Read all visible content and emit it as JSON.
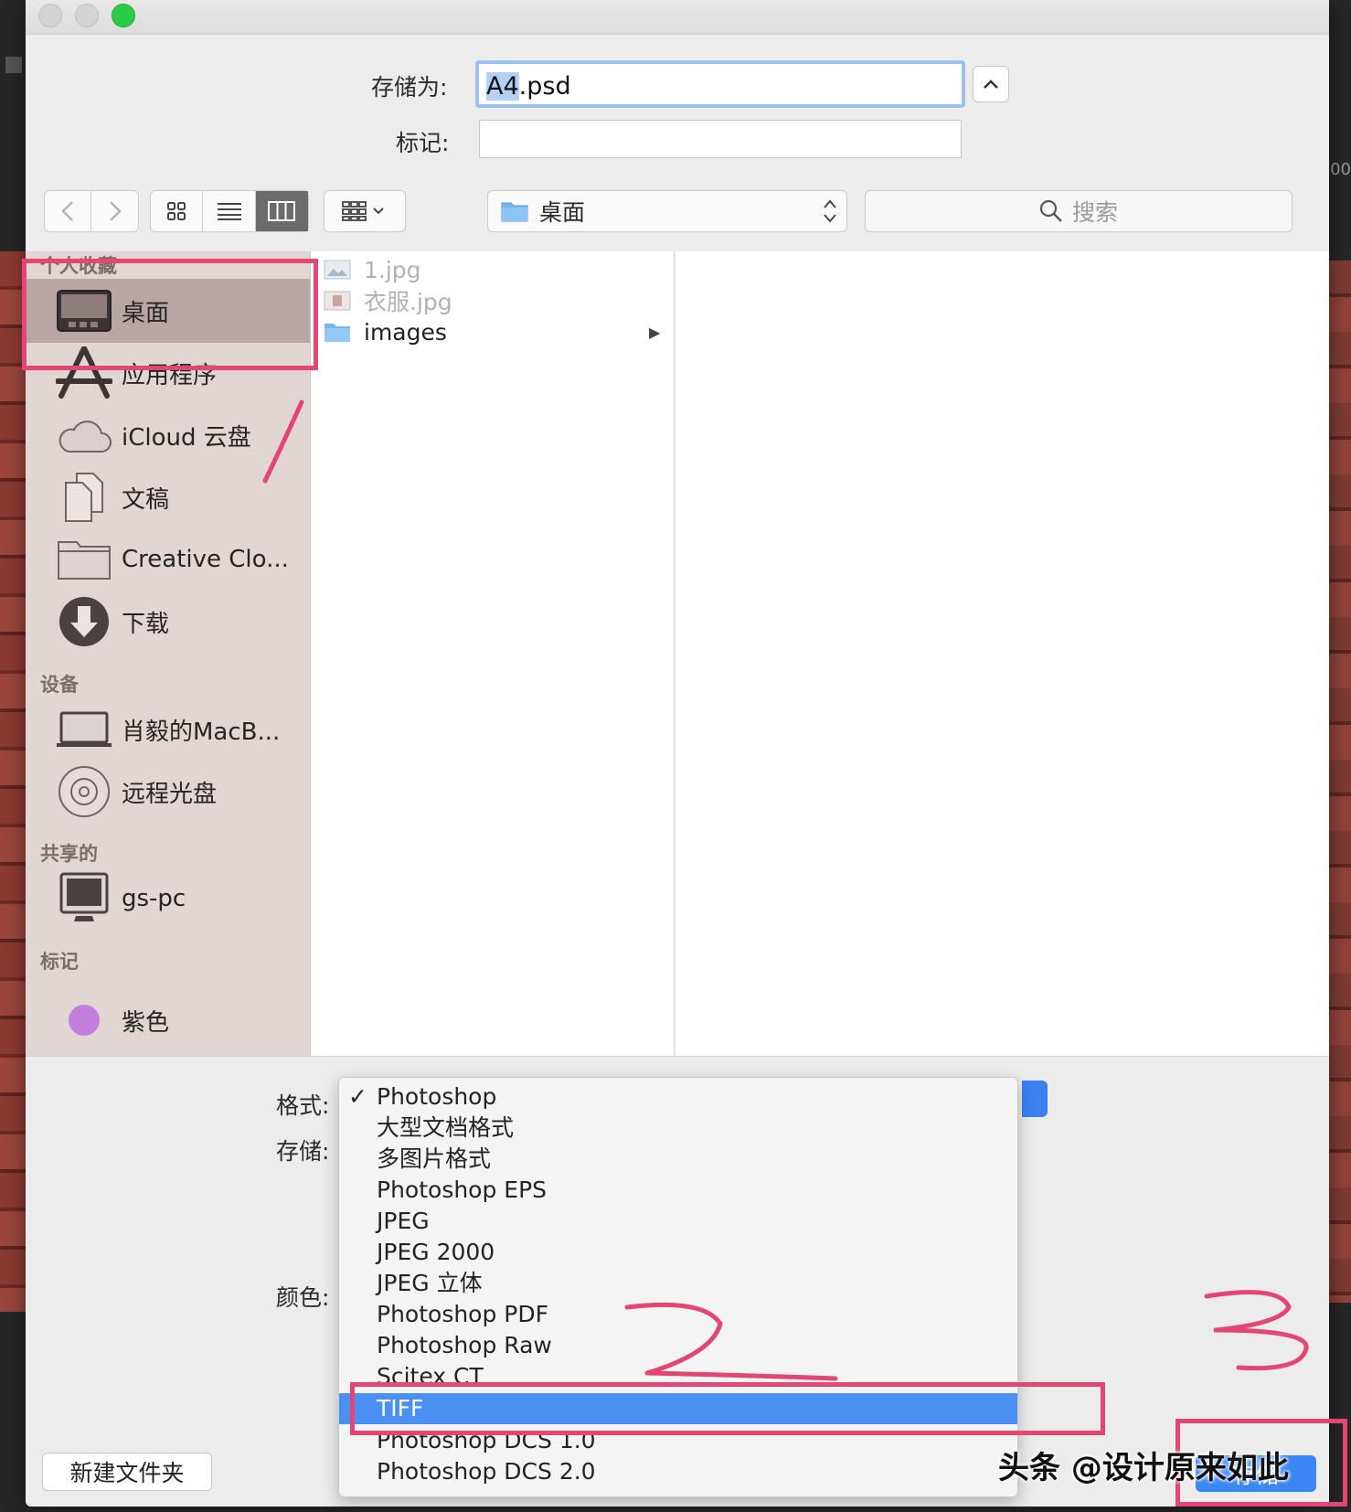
{
  "form": {
    "saveas_label": "存储为:",
    "filename_selected": "A4",
    "filename_ext": ".psd",
    "tags_label": "标记:"
  },
  "toolbar": {
    "location": "桌面",
    "search_placeholder": "搜索"
  },
  "sidebar": {
    "favorites_header": "个人收藏",
    "favorites": [
      "桌面",
      "应用程序",
      "iCloud 云盘",
      "文稿",
      "Creative Clo...",
      "下载"
    ],
    "devices_header": "设备",
    "devices": [
      "肖毅的MacB...",
      "远程光盘"
    ],
    "shared_header": "共享的",
    "shared": [
      "gs-pc"
    ],
    "tags_header": "标记",
    "tags": [
      "紫色"
    ]
  },
  "files": [
    {
      "name": "1.jpg",
      "kind": "image",
      "enabled": false
    },
    {
      "name": "衣服.jpg",
      "kind": "image",
      "enabled": false
    },
    {
      "name": "images",
      "kind": "folder",
      "enabled": true
    }
  ],
  "bottom": {
    "format_label": "格式:",
    "save_label": "存储:",
    "color_label": "颜色:",
    "new_folder": "新建文件夹",
    "save_button": "存储"
  },
  "format_menu": {
    "checked": "Photoshop",
    "highlighted": "TIFF",
    "items": [
      "Photoshop",
      "大型文档格式",
      "多图片格式",
      "Photoshop EPS",
      "JPEG",
      "JPEG 2000",
      "JPEG 立体",
      "Photoshop PDF",
      "Photoshop Raw",
      "Scitex CT",
      "TIFF",
      "Photoshop DCS 1.0",
      "Photoshop DCS 2.0"
    ]
  },
  "annotations": {
    "step1": "1",
    "step2": "2",
    "step3": "3"
  },
  "watermark": "头条 @设计原来如此",
  "background": {
    "ruler_text": "00"
  },
  "colors": {
    "annotation": "#e44673",
    "accent": "#3a86f4",
    "sidebar": "#e2d6d5",
    "sidebar_selected": "#b9a5a3"
  }
}
